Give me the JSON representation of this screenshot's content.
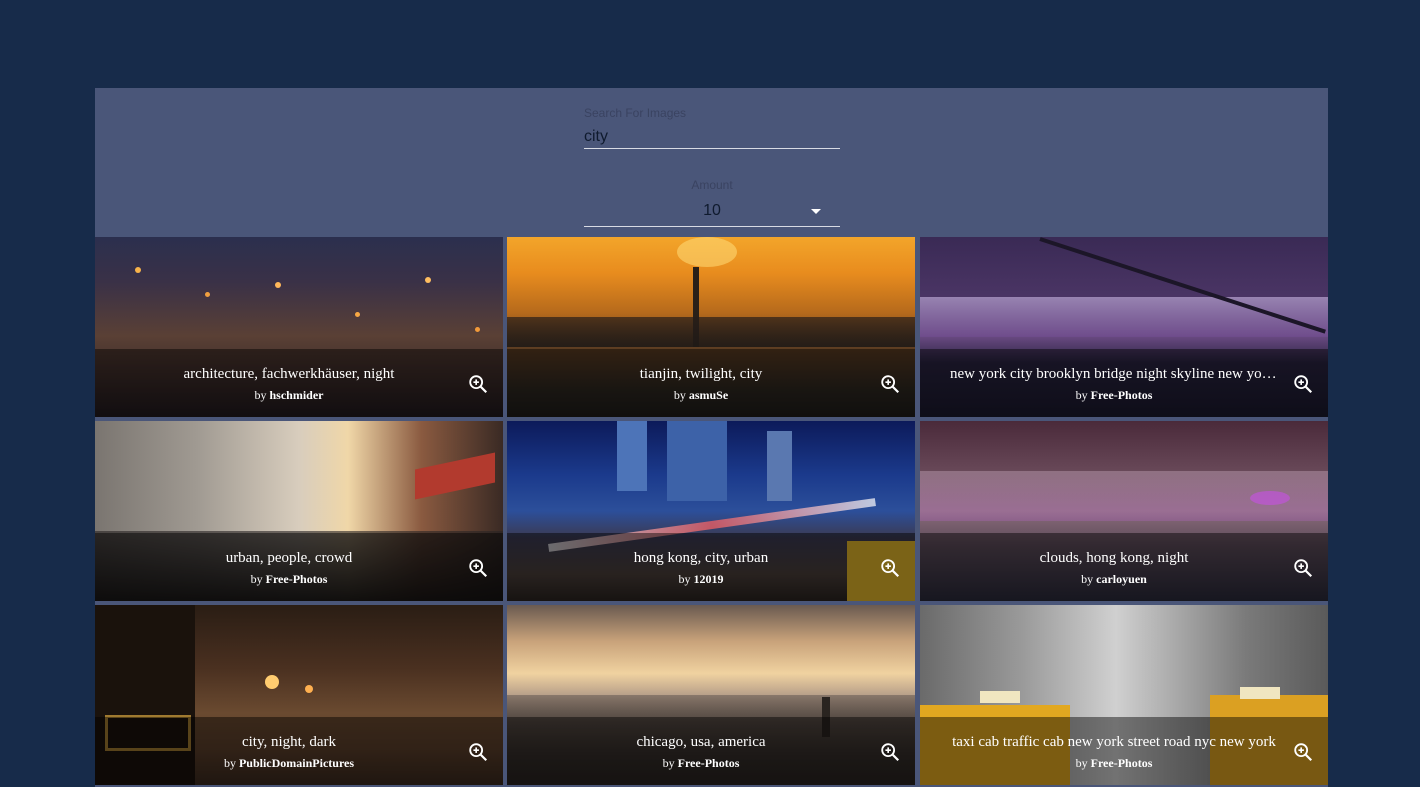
{
  "search": {
    "label": "Search For Images",
    "value": "city"
  },
  "amount": {
    "label": "Amount",
    "value": "10"
  },
  "images": [
    {
      "title": "architecture, fachwerkhäuser, night",
      "by_prefix": "by",
      "author": "hschmider"
    },
    {
      "title": "tianjin, twilight, city",
      "by_prefix": "by",
      "author": "asmuSe"
    },
    {
      "title": "new york city brooklyn bridge night skyline new york city",
      "by_prefix": "by",
      "author": "Free-Photos"
    },
    {
      "title": "urban, people, crowd",
      "by_prefix": "by",
      "author": "Free-Photos"
    },
    {
      "title": "hong kong, city, urban",
      "by_prefix": "by",
      "author": "12019"
    },
    {
      "title": "clouds, hong kong, night",
      "by_prefix": "by",
      "author": "carloyuen"
    },
    {
      "title": "city, night, dark",
      "by_prefix": "by",
      "author": "PublicDomainPictures"
    },
    {
      "title": "chicago, usa, america",
      "by_prefix": "by",
      "author": "Free-Photos"
    },
    {
      "title": "taxi cab traffic cab new york street road nyc new york",
      "by_prefix": "by",
      "author": "Free-Photos"
    }
  ],
  "icons": {
    "zoom": "zoom-in-icon",
    "dropdown": "arrow-drop-down-icon"
  },
  "colors": {
    "page_background": "#172b4a",
    "panel_background": "#4a5679",
    "text_on_image": "#ffffff"
  }
}
